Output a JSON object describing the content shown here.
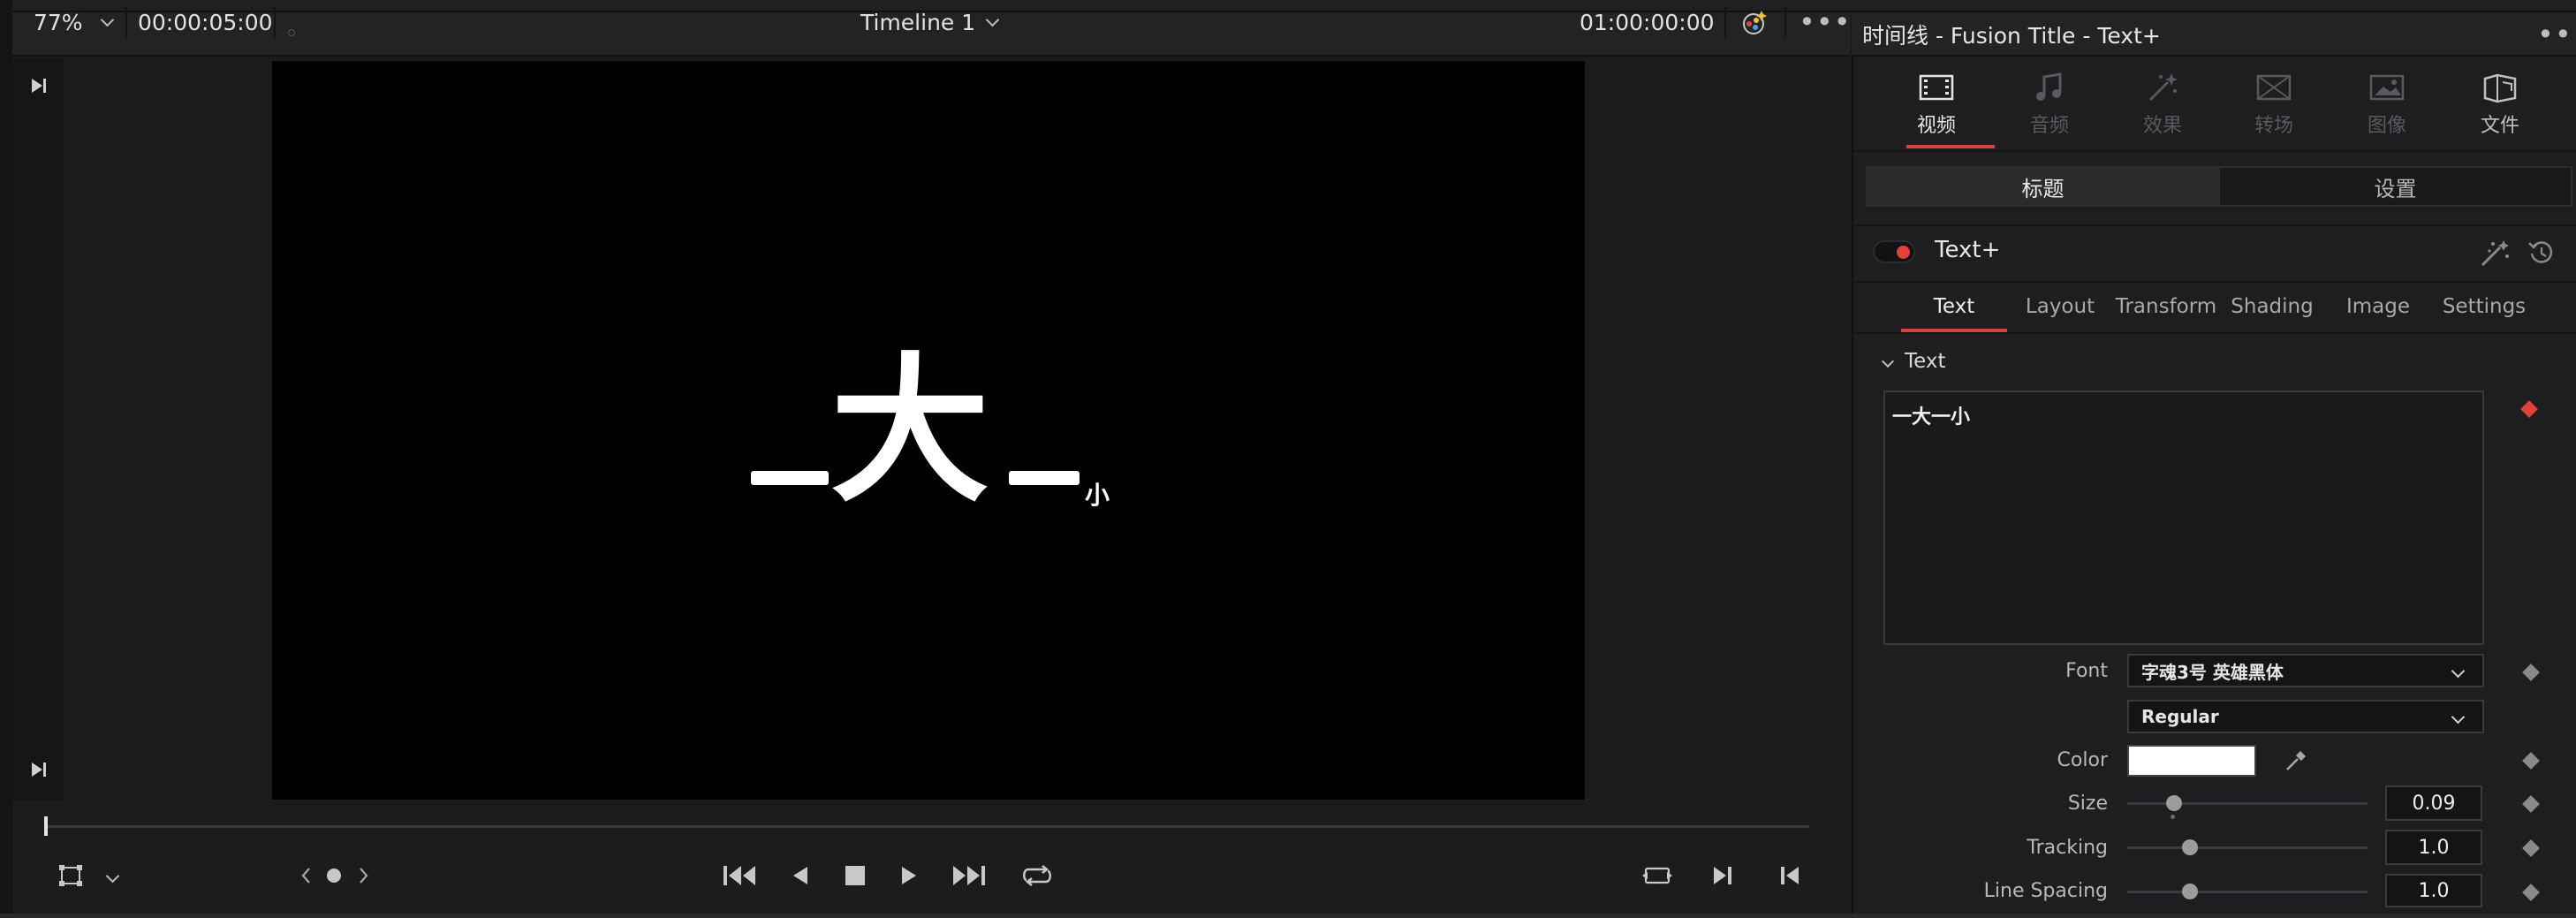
{
  "viewer": {
    "zoom": "77%",
    "duration": "00:00:05:00",
    "timeline_name": "Timeline 1",
    "timecode": "01:00:00:00",
    "canvas_text": {
      "first": "一",
      "big": "大",
      "second": "一",
      "small": "小"
    }
  },
  "inspector": {
    "title": "时间线 - Fusion Title - Text+",
    "categories": [
      {
        "label": "视频",
        "icon": "film-icon",
        "active": true
      },
      {
        "label": "音频",
        "icon": "music-note-icon",
        "active": false
      },
      {
        "label": "效果",
        "icon": "magic-wand-icon",
        "active": false
      },
      {
        "label": "转场",
        "icon": "transition-icon",
        "active": false
      },
      {
        "label": "图像",
        "icon": "image-icon",
        "active": false
      },
      {
        "label": "文件",
        "icon": "file-icon",
        "active": false
      }
    ],
    "subtabs": [
      "标题",
      "设置"
    ],
    "tool_name": "Text+",
    "param_tabs": [
      "Text",
      "Layout",
      "Transform",
      "Shading",
      "Image",
      "Settings"
    ],
    "section": "Text",
    "text_value": "一大一小",
    "props": {
      "font_label": "Font",
      "font_value": "字魂3号 英雄黑体",
      "style_value": "Regular",
      "color_label": "Color",
      "color_value": "#ffffff",
      "size_label": "Size",
      "size_value": "0.09",
      "tracking_label": "Tracking",
      "tracking_value": "1.0",
      "line_spacing_label": "Line Spacing",
      "line_spacing_value": "1.0"
    }
  },
  "colors": {
    "accent": "#d1453b",
    "keyframe": "#e0423a"
  }
}
